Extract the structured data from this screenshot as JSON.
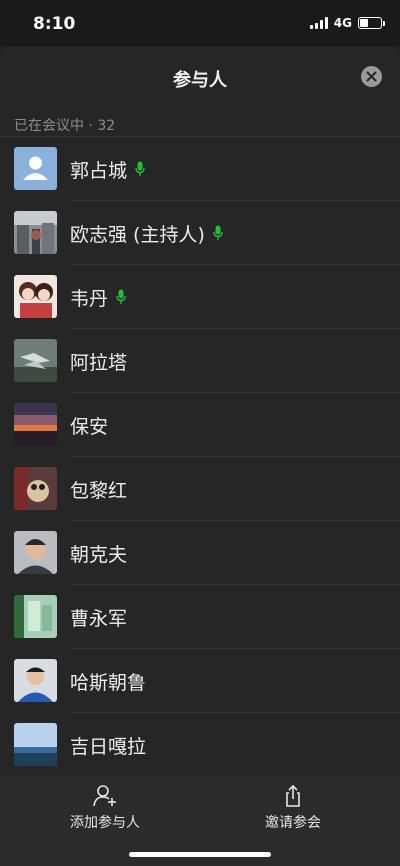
{
  "status_bar": {
    "time": "8:10",
    "network": "4G",
    "battery_level": 0.4
  },
  "header": {
    "title": "参与人"
  },
  "section": {
    "label": "已在会议中 · 32"
  },
  "participants": [
    {
      "name": "郭占城",
      "muted": false,
      "avatar": "placeholder-person"
    },
    {
      "name": "欧志强 (主持人)",
      "muted": false,
      "avatar": "photo-street"
    },
    {
      "name": "韦丹",
      "muted": false,
      "avatar": "photo-anime"
    },
    {
      "name": "阿拉塔",
      "muted": true,
      "avatar": "photo-birds"
    },
    {
      "name": "保安",
      "muted": true,
      "avatar": "photo-sunset"
    },
    {
      "name": "包黎红",
      "muted": true,
      "avatar": "photo-dog"
    },
    {
      "name": "朝克夫",
      "muted": true,
      "avatar": "photo-man"
    },
    {
      "name": "曹永军",
      "muted": true,
      "avatar": "photo-green"
    },
    {
      "name": "哈斯朝鲁",
      "muted": true,
      "avatar": "photo-child"
    },
    {
      "name": "吉日嘎拉",
      "muted": true,
      "avatar": "photo-sea"
    }
  ],
  "actions": {
    "add_label": "添加参与人",
    "invite_label": "邀请参会"
  },
  "colors": {
    "mic_active": "#1fbf3a",
    "background": "#262626"
  }
}
